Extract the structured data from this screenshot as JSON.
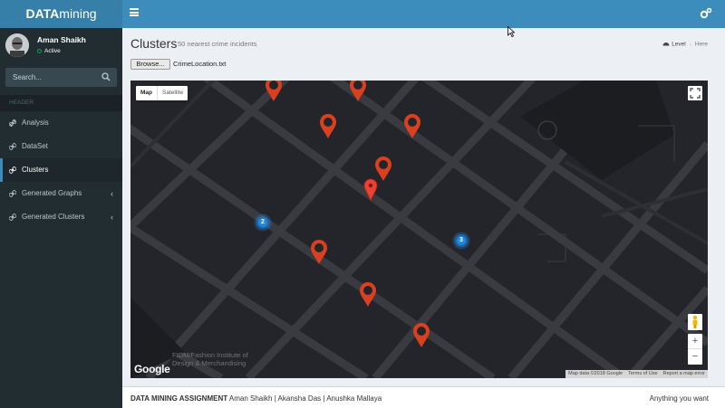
{
  "header": {
    "logo_bold": "DATA",
    "logo_rest": "mining"
  },
  "user": {
    "name": "Aman Shaikh",
    "status": "Active"
  },
  "search": {
    "placeholder": "Search..."
  },
  "sidebar": {
    "header": "HEADER",
    "items": [
      {
        "label": "Analysis",
        "active": false,
        "has_children": false
      },
      {
        "label": "DataSet",
        "active": false,
        "has_children": false
      },
      {
        "label": "Clusters",
        "active": true,
        "has_children": false
      },
      {
        "label": "Generated Graphs",
        "active": false,
        "has_children": true
      },
      {
        "label": "Generated Clusters",
        "active": false,
        "has_children": true
      }
    ]
  },
  "page": {
    "title": "Clusters",
    "subtitle": "50 nearest crime incidents",
    "breadcrumb_level": "Level",
    "breadcrumb_here": "Here",
    "browse_label": "Browse...",
    "file_name": "CrimeLocation.txt"
  },
  "map": {
    "type_map": "Map",
    "type_satellite": "Satellite",
    "place_label_line1": "FIDM/Fashion Institute of",
    "place_label_line2": "Design & Merchandising",
    "google": "Google",
    "map_data": "Map data ©2018 Google",
    "terms": "Terms of Use",
    "report": "Report a map error",
    "zoom_in": "+",
    "zoom_out": "−",
    "clusters": [
      {
        "count": "2"
      },
      {
        "count": "3"
      }
    ]
  },
  "footer": {
    "title": "DATA MINING ASSIGNMENT",
    "authors": "Aman Shaikh | Akansha Das | Anushka Mallaya",
    "right": "Anything you want"
  },
  "colors": {
    "header": "#3c8dbc",
    "logo_bg": "#367fa9",
    "sidebar": "#222d32",
    "pin": "#d9401f",
    "cluster": "#1e88e5",
    "map_bg": "#24252a"
  }
}
